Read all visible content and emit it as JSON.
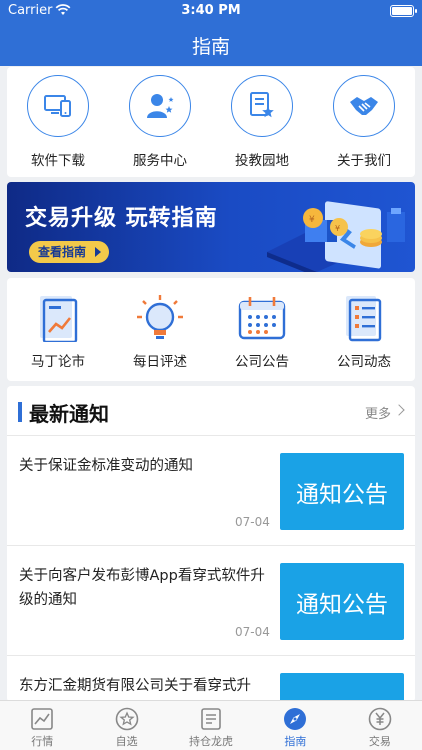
{
  "status": {
    "carrier": "Carrier",
    "time": "3:40 PM"
  },
  "nav": {
    "title": "指南"
  },
  "quick_links": [
    {
      "label": "软件下载",
      "icon": "monitor-phone-icon"
    },
    {
      "label": "服务中心",
      "icon": "service-person-icon"
    },
    {
      "label": "投教园地",
      "icon": "education-doc-star-icon"
    },
    {
      "label": "关于我们",
      "icon": "handshake-icon"
    }
  ],
  "banner": {
    "headline": "交易升级 玩转指南",
    "cta": "查看指南"
  },
  "features": [
    {
      "label": "马丁论市",
      "icon": "chart-doc-icon"
    },
    {
      "label": "每日评述",
      "icon": "lightbulb-icon"
    },
    {
      "label": "公司公告",
      "icon": "calendar-icon"
    },
    {
      "label": "公司动态",
      "icon": "news-doc-icon"
    }
  ],
  "news": {
    "heading": "最新通知",
    "more": "更多",
    "items": [
      {
        "title": "关于保证金标准变动的通知",
        "date": "07-04",
        "thumb": "通知公告"
      },
      {
        "title": "关于向客户发布彭博App看穿式软件升级的通知",
        "date": "07-04",
        "thumb": "通知公告"
      },
      {
        "title": "东方汇金期货有限公司关于看穿式升",
        "date": "",
        "thumb": ""
      }
    ]
  },
  "tabs": [
    {
      "label": "行情",
      "icon": "chart-line-icon",
      "active": false
    },
    {
      "label": "自选",
      "icon": "star-circle-icon",
      "active": false
    },
    {
      "label": "持仓龙虎",
      "icon": "list-doc-icon",
      "active": false
    },
    {
      "label": "指南",
      "icon": "compass-icon",
      "active": true
    },
    {
      "label": "交易",
      "icon": "yuan-circle-icon",
      "active": false
    }
  ],
  "colors": {
    "brand": "#2f6fd6",
    "thumb": "#1aa2e6",
    "cta": "#f3c94a"
  }
}
